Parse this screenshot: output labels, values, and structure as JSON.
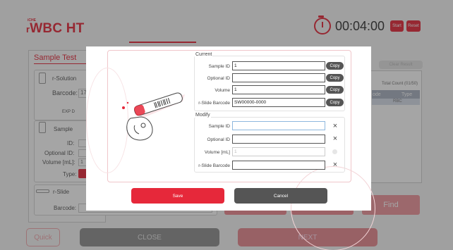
{
  "header": {
    "logo_sub": "iCHE",
    "logo_main": "WBC HT",
    "logo_prefix": "r",
    "timer": "00:04:00",
    "start_label": "Start",
    "reset_label": "Reset"
  },
  "left_panel": {
    "tab_label": "Sample Test",
    "r_solution_label": "r-Solution",
    "barcode_label": "Barcode:",
    "barcode_value": "17",
    "exp_label": "EXP D",
    "sample_label": "Sample",
    "id_label": "ID:",
    "optional_id_label": "Optional ID:",
    "volume_label": "Volume [mL]:",
    "volume_value": "1",
    "type_label": "Type:",
    "rslide_label": "r-Slide",
    "rslide_barcode_label": "Barcode:"
  },
  "right_panel": {
    "pill_label": "Clear Result",
    "total_count": "Total Count (01/50)",
    "col_code": "ode",
    "col_type": "Type",
    "row_type": "RBC",
    "find_label": "Find"
  },
  "bottom": {
    "quick_label": "Quick",
    "close_label": "CLOSE",
    "next_label": "NEXT"
  },
  "dialog": {
    "current": {
      "title": "Current",
      "rows": [
        {
          "label": "Sample ID",
          "value": "1",
          "action": "Copy"
        },
        {
          "label": "Optional ID",
          "value": "",
          "action": "Copy"
        },
        {
          "label": "Volume",
          "value": "1",
          "action": "Copy"
        },
        {
          "label": "r-Slide Barcode",
          "value": "SW00000-0000",
          "action": "Copy"
        }
      ]
    },
    "modify": {
      "title": "Modify",
      "rows": [
        {
          "label": "Sample ID",
          "value": ""
        },
        {
          "label": "Optional ID",
          "value": ""
        },
        {
          "label": "Volume [mL]",
          "value": "1"
        },
        {
          "label": "r-Slide Barcode",
          "value": ""
        }
      ]
    },
    "clear_icon": "×",
    "save_label": "Save",
    "cancel_label": "Cancel"
  },
  "colors": {
    "accent": "#e6283a",
    "dark_button": "#555555"
  }
}
